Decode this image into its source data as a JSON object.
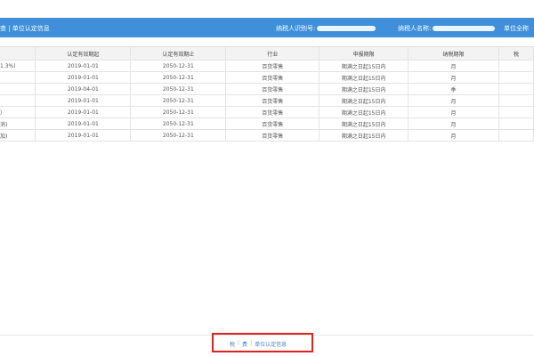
{
  "header": {
    "title_partial": "查 | 单位认定信息",
    "taxpayer_id_label": "纳税人识别号:",
    "taxpayer_name_label": "纳税人名称:",
    "cut_label": "单位全称"
  },
  "table": {
    "columns": [
      "",
      "认定有效期起",
      "认定有效期止",
      "行业",
      "申报期限",
      "纳税期限",
      "税"
    ],
    "rows": [
      {
        "name": "1.3%)",
        "start": "2019-01-01",
        "end": "2050-12-31",
        "industry": "百货零售",
        "deadline": "期满之日起15日内",
        "period": "月",
        "extra": ""
      },
      {
        "name": "",
        "start": "2019-01-01",
        "end": "2050-12-31",
        "industry": "百货零售",
        "deadline": "期满之日起15日内",
        "period": "月",
        "extra": ""
      },
      {
        "name": "",
        "start": "2019-04-01",
        "end": "2050-12-31",
        "industry": "百货零售",
        "deadline": "期满之日起15日内",
        "period": "季",
        "extra": ""
      },
      {
        "name": "",
        "start": "2019-01-01",
        "end": "2050-12-31",
        "industry": "百货零售",
        "deadline": "期满之日起15日内",
        "period": "月",
        "extra": ""
      },
      {
        "name": "）",
        "start": "2019-01-01",
        "end": "2050-12-31",
        "industry": "百货零售",
        "deadline": "期满之日起15日内",
        "period": "月",
        "extra": ""
      },
      {
        "name": "消)",
        "start": "2019-01-01",
        "end": "2050-12-31",
        "industry": "百货零售",
        "deadline": "期满之日起15日内",
        "period": "月",
        "extra": ""
      },
      {
        "name": "加)",
        "start": "2019-01-01",
        "end": "2050-12-31",
        "industry": "百货零售",
        "deadline": "期满之日起15日内",
        "period": "月",
        "extra": ""
      }
    ]
  },
  "bottom_bar": {
    "tab_1": "税",
    "sep": "|",
    "tab_2": "费",
    "tab_3": "单位认定信息"
  }
}
